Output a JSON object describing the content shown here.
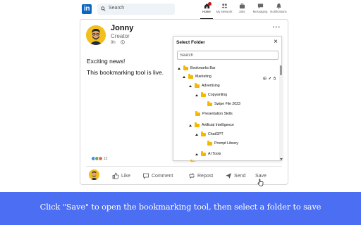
{
  "nav": {
    "logo_text": "in",
    "search_placeholder": "Search",
    "items": [
      {
        "label": "Home",
        "icon": "home-icon",
        "active": true
      },
      {
        "label": "My Network",
        "icon": "network-icon",
        "active": false
      },
      {
        "label": "Jobs",
        "icon": "briefcase-icon",
        "active": false
      },
      {
        "label": "Messaging",
        "icon": "messaging-icon",
        "active": false
      },
      {
        "label": "Notifications",
        "icon": "bell-icon",
        "active": false
      }
    ]
  },
  "post": {
    "author": "Jonny",
    "subtitle": "Creator",
    "time": "9h",
    "line1": "Exciting news!",
    "line2": "This bookmarking tool is live.",
    "reaction_count": "12",
    "actions": {
      "like": "Like",
      "comment": "Comment",
      "repost": "Repost",
      "send": "Send",
      "save": "Save"
    }
  },
  "dialog": {
    "title": "Select Folder",
    "close": "×",
    "search_placeholder": "Search",
    "tree": [
      {
        "label": "Bookmarks Bar",
        "level": 0,
        "expanded": true
      },
      {
        "label": "Marketing",
        "level": 1,
        "expanded": true,
        "hovered": true
      },
      {
        "label": "Advertising",
        "level": 2,
        "expanded": true
      },
      {
        "label": "Copywriting",
        "level": 3,
        "expanded": true
      },
      {
        "label": "Swipe File 2023",
        "level": 4,
        "expanded": false
      },
      {
        "label": "Presentation Skills",
        "level": 2,
        "expanded": false
      },
      {
        "label": "Artificial Intelligence",
        "level": 2,
        "expanded": true
      },
      {
        "label": "ChatGPT",
        "level": 3,
        "expanded": true
      },
      {
        "label": "Prompt Library",
        "level": 4,
        "expanded": false
      },
      {
        "label": "AI Tools",
        "level": 3,
        "expanded": true
      }
    ]
  },
  "banner": {
    "text": "Click \"Save\" to open the bookmarking tool, then select a folder to save"
  },
  "colors": {
    "linkedin_blue": "#0a66c2",
    "banner_blue": "#4c6ef2",
    "folder_yellow": "#f5b800",
    "avatar_yellow": "#f2c01e"
  }
}
